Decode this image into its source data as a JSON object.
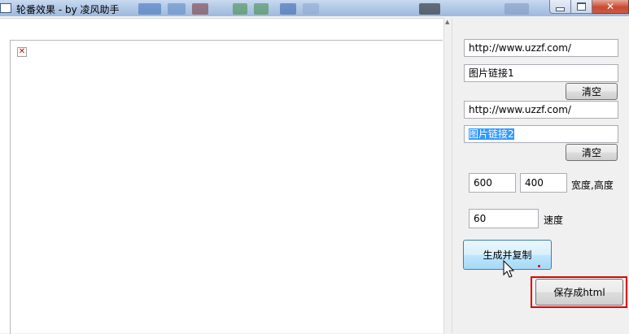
{
  "window": {
    "title": "轮番效果 - by 凌风助手"
  },
  "preview": {
    "broken_image_icon": "broken-image-icon"
  },
  "form": {
    "url1": "http://www.uzzf.com/",
    "link1": "图片链接1",
    "clear1_label": "清空",
    "url2": "http://www.uzzf.com/",
    "link2": "图片链接2",
    "clear2_label": "清空",
    "width": "600",
    "height": "400",
    "size_label": "宽度,高度",
    "speed": "60",
    "speed_label": "速度",
    "generate_label": "生成并复制",
    "save_label": "保存成html"
  },
  "colors": {
    "highlight": "#e00000",
    "selection": "#3399ff",
    "primary_button": "#bee6fd"
  }
}
